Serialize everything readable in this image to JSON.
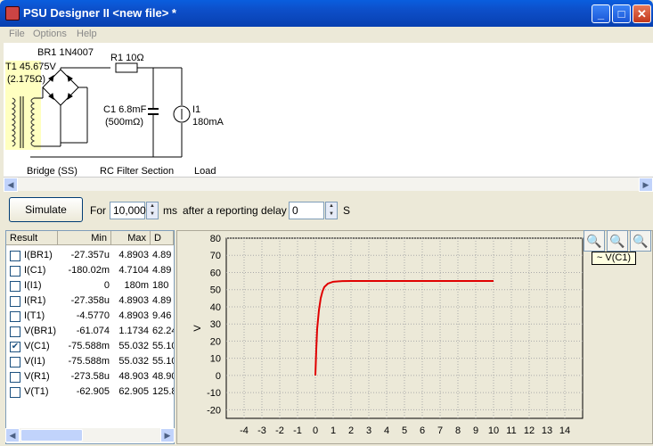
{
  "window": {
    "title": "PSU Designer II  <new file> *",
    "minimize": "_",
    "maximize": "□",
    "close": "✕"
  },
  "menu": {
    "items": [
      "File",
      "Options",
      "Help"
    ]
  },
  "circuit": {
    "rectifier_label": "BR1 1N4007",
    "transformer_label": "T1 45.675V",
    "transformer_res": "(2.175Ω)",
    "resistor_label": "R1 10Ω",
    "cap_label": "C1 6.8mF",
    "cap_res": "(500mΩ)",
    "load_label": "I1",
    "load_value": "180mA",
    "section_bridge": "Bridge (SS)",
    "section_filter": "RC Filter Section",
    "section_load": "Load"
  },
  "toolbar": {
    "simulate_label": "Simulate",
    "for_label": "For",
    "duration_value": "10,000",
    "ms_label": "ms",
    "delay_label": "after a reporting delay of",
    "delay_value": "0",
    "s_label": "S"
  },
  "results": {
    "columns": [
      "Result",
      "Min",
      "Max",
      "D"
    ],
    "rows": [
      {
        "name": "I(BR1)",
        "min": "-27.357u",
        "max": "4.8903",
        "d": "4.89",
        "checked": false
      },
      {
        "name": "I(C1)",
        "min": "-180.02m",
        "max": "4.7104",
        "d": "4.89",
        "checked": false
      },
      {
        "name": "I(I1)",
        "min": "0",
        "max": "180m",
        "d": "180",
        "checked": false
      },
      {
        "name": "I(R1)",
        "min": "-27.358u",
        "max": "4.8903",
        "d": "4.89",
        "checked": false
      },
      {
        "name": "I(T1)",
        "min": "-4.5770",
        "max": "4.8903",
        "d": "9.46",
        "checked": false
      },
      {
        "name": "V(BR1)",
        "min": "-61.074",
        "max": "1.1734",
        "d": "62.24",
        "checked": false
      },
      {
        "name": "V(C1)",
        "min": "-75.588m",
        "max": "55.032",
        "d": "55.10",
        "checked": true
      },
      {
        "name": "V(I1)",
        "min": "-75.588m",
        "max": "55.032",
        "d": "55.10",
        "checked": false
      },
      {
        "name": "V(R1)",
        "min": "-273.58u",
        "max": "48.903",
        "d": "48.90",
        "checked": false
      },
      {
        "name": "V(T1)",
        "min": "-62.905",
        "max": "62.905",
        "d": "125.8",
        "checked": false
      }
    ]
  },
  "chart_data": {
    "type": "line",
    "ylabel": "V",
    "xlim": [
      -5,
      15
    ],
    "ylim": [
      -25,
      80
    ],
    "xticks": [
      -4,
      -3,
      -2,
      -1,
      0,
      1,
      2,
      3,
      4,
      5,
      6,
      7,
      8,
      9,
      10,
      11,
      12,
      13,
      14
    ],
    "yticks": [
      80,
      70,
      60,
      50,
      40,
      30,
      20,
      10,
      0,
      -10,
      -20
    ],
    "grid": true,
    "legend_position": "top-right",
    "series": [
      {
        "name": "V(C1)",
        "color": "#e00000",
        "x": [
          0,
          0.05,
          0.1,
          0.2,
          0.3,
          0.4,
          0.5,
          0.7,
          1.0,
          1.5,
          2,
          4,
          6,
          8,
          10
        ],
        "y": [
          0,
          15,
          27,
          38,
          45,
          49,
          51.5,
          53.5,
          54.6,
          55.0,
          55.03,
          55.03,
          55.03,
          55.03,
          55.03
        ]
      }
    ]
  },
  "legend": {
    "label": "~ V(C1)"
  },
  "colors": {
    "title_bar": "#0d4ec8",
    "series": "#e00000",
    "plot_bg": "#ece9d8"
  }
}
